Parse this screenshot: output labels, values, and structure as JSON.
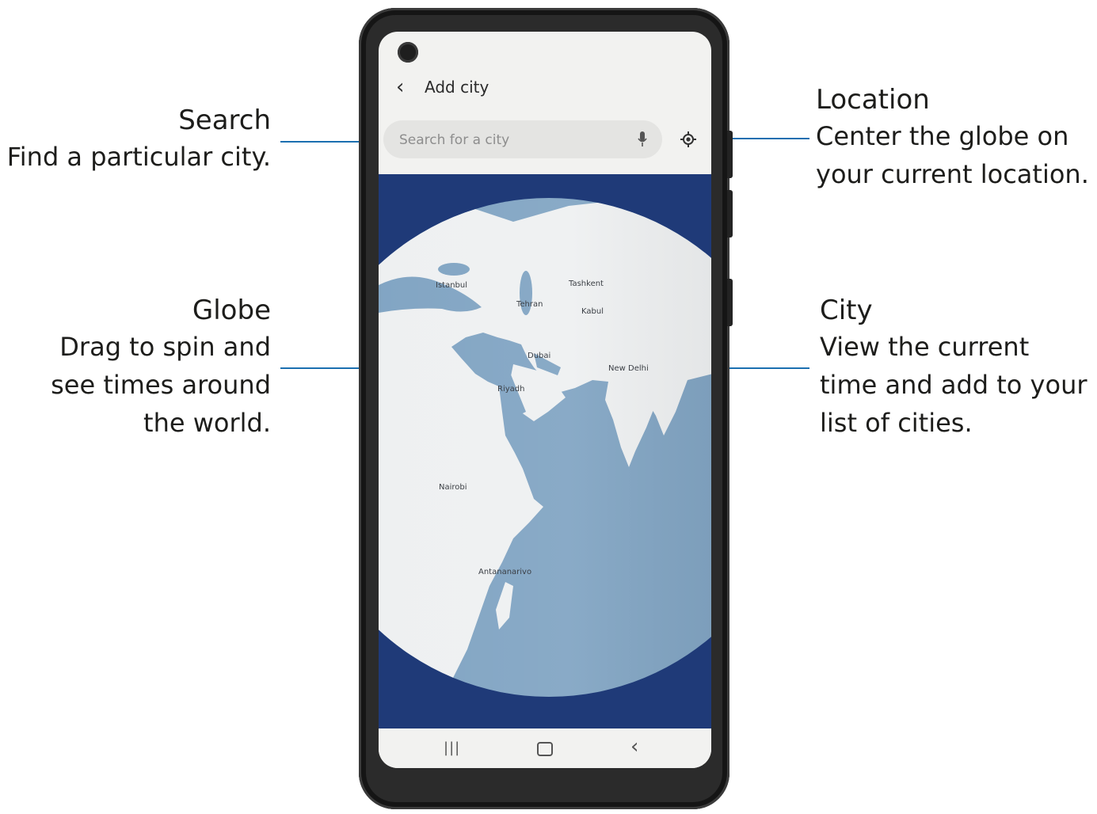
{
  "callouts": {
    "search": {
      "title": "Search",
      "desc1": "Find a particular city."
    },
    "globe": {
      "title": "Globe",
      "desc1": "Drag to spin and",
      "desc2": "see times around",
      "desc3": "the world."
    },
    "location": {
      "title": "Location",
      "desc1": "Center the globe on",
      "desc2": "your current location."
    },
    "city": {
      "title": "City",
      "desc1": "View the current",
      "desc2": "time and add to your",
      "desc3": "list of cities."
    }
  },
  "app": {
    "title": "Add city",
    "search_placeholder": "Search for a city",
    "icons": {
      "back": "back-arrow-icon",
      "mic": "microphone-icon",
      "location": "location-target-icon"
    }
  },
  "cities": [
    {
      "name": "Istanbul"
    },
    {
      "name": "Tehran"
    },
    {
      "name": "Tashkent"
    },
    {
      "name": "Kabul"
    },
    {
      "name": "Dubai"
    },
    {
      "name": "Riyadh"
    },
    {
      "name": "New Delhi"
    },
    {
      "name": "Nairobi"
    },
    {
      "name": "Antananarivo"
    }
  ],
  "colors": {
    "leader": "#1b6fb0",
    "map_background": "#1f3a78",
    "ocean": "#7fa3c2",
    "land": "#eef0f1"
  }
}
